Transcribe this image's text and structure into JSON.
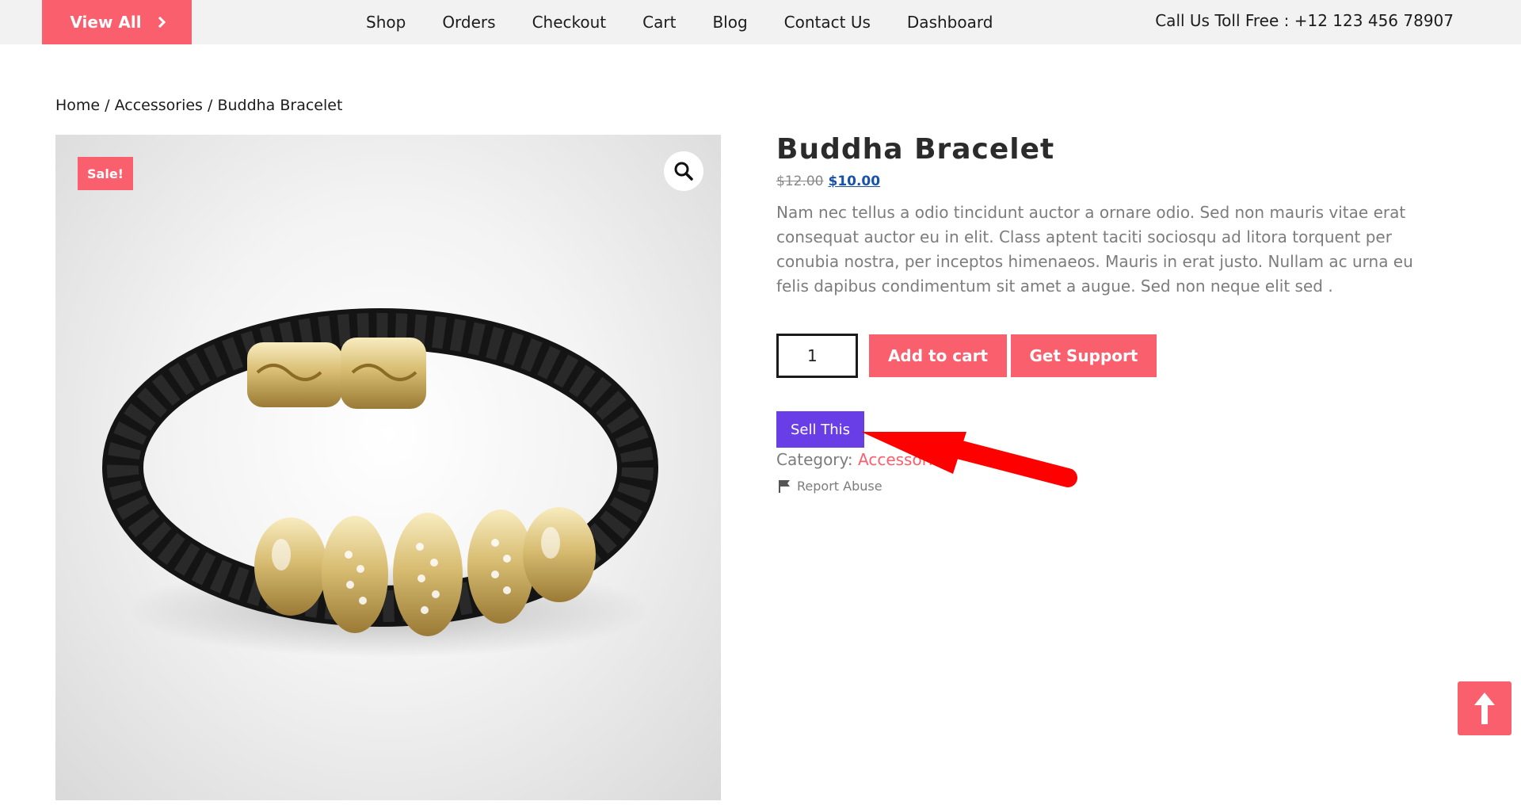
{
  "topbar": {
    "view_all_label": "View All",
    "nav": [
      "Shop",
      "Orders",
      "Checkout",
      "Cart",
      "Blog",
      "Contact Us",
      "Dashboard"
    ],
    "toll_free": "Call Us Toll Free : +12 123 456 78907"
  },
  "breadcrumb": {
    "home": "Home",
    "sep": " / ",
    "category": "Accessories",
    "current": "Buddha Bracelet"
  },
  "product": {
    "sale_badge": "Sale!",
    "title": "Buddha Bracelet",
    "old_price": "$12.00",
    "new_price": "$10.00",
    "description": "Nam nec tellus a odio tincidunt auctor a ornare odio. Sed non mauris vitae erat consequat auctor eu in elit. Class aptent taciti sociosqu ad litora torquent per conubia nostra, per inceptos himenaeos. Mauris in erat justo. Nullam ac urna eu felis dapibus condimentum sit amet a augue. Sed non neque elit sed .",
    "quantity": "1",
    "add_to_cart_label": "Add to cart",
    "get_support_label": "Get Support",
    "sell_this_label": "Sell This",
    "category_label": "Category:",
    "category_value": "Accessories",
    "report_abuse_label": "Report Abuse"
  },
  "colors": {
    "accent": "#fa5f6d",
    "sell_button": "#6a3ee6",
    "price_link": "#1a52a8",
    "annotation_arrow": "#ff0000"
  },
  "icons": {
    "chevron": "chevron-right-icon",
    "zoom": "magnifier-icon",
    "report": "flag-icon",
    "scroll_top": "arrow-up-icon"
  }
}
